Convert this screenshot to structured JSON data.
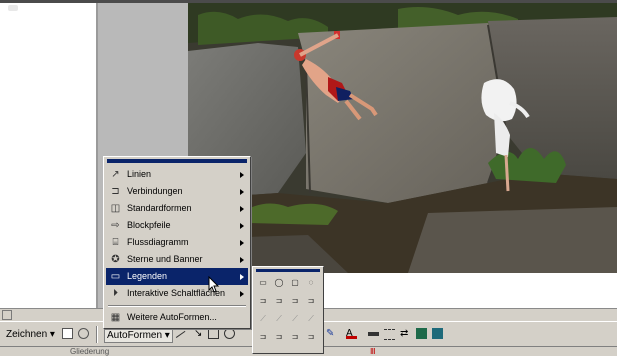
{
  "drawing_toolbar": {
    "draw_label": "Zeichnen",
    "autoshapes_label": "AutoFormen",
    "accent_color": "#0a246a"
  },
  "autoshapes_menu": {
    "items": [
      {
        "label": "Linien",
        "icon": "lines-icon",
        "has_submenu": true
      },
      {
        "label": "Verbindungen",
        "icon": "connectors-icon",
        "has_submenu": true
      },
      {
        "label": "Standardformen",
        "icon": "basic-shapes-icon",
        "has_submenu": true
      },
      {
        "label": "Blockpfeile",
        "icon": "block-arrows-icon",
        "has_submenu": true
      },
      {
        "label": "Flussdiagramm",
        "icon": "flowchart-icon",
        "has_submenu": true
      },
      {
        "label": "Sterne und Banner",
        "icon": "stars-banners-icon",
        "has_submenu": true
      },
      {
        "label": "Legenden",
        "icon": "callouts-icon",
        "has_submenu": true,
        "active": true
      },
      {
        "label": "Interaktive Schaltflächen",
        "icon": "action-buttons-icon",
        "has_submenu": true
      },
      {
        "label": "Weitere AutoFormen...",
        "icon": "more-autoshapes-icon",
        "has_submenu": false
      }
    ]
  },
  "callouts_submenu": {
    "rows": [
      [
        "▭",
        "◯",
        "▢",
        "◌"
      ],
      [
        "⊐",
        "⊐",
        "⊐",
        "⊐"
      ],
      [
        "⟋",
        "⟋",
        "⟋",
        "⟋"
      ],
      [
        "⊐",
        "⊐",
        "⊐",
        "⊐"
      ]
    ]
  },
  "statusbar": {
    "left_text": "Gliederung"
  },
  "icons": {
    "scroll_left": "scroll-left-arrow-icon",
    "cursor": "mouse-pointer-icon"
  }
}
